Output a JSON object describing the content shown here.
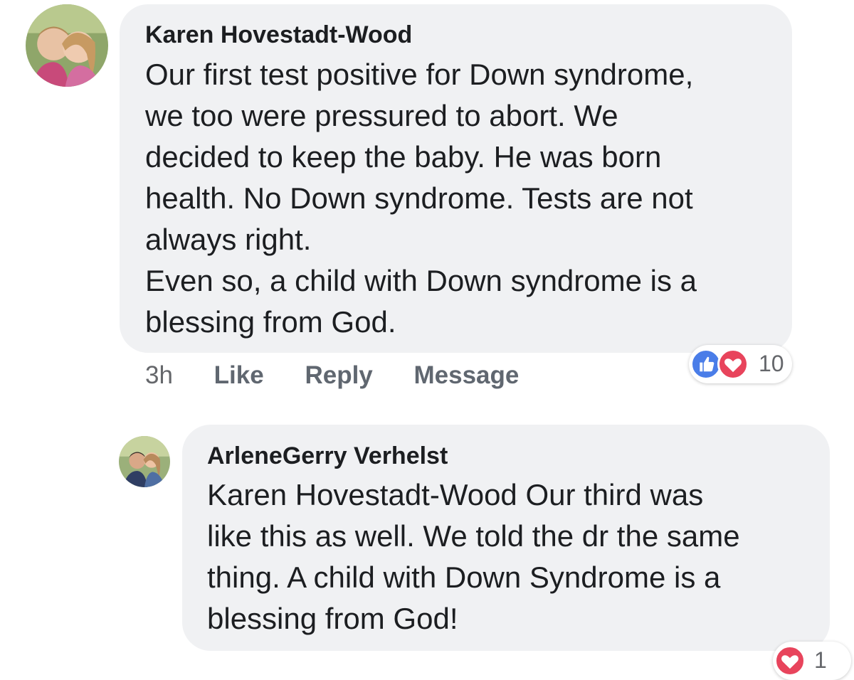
{
  "colors": {
    "bubble": "#f0f1f3",
    "like_blue": "#4a7de8",
    "love_red": "#e8445c",
    "meta_text": "#65676b"
  },
  "comments": [
    {
      "author": "Karen Hovestadt-Wood",
      "text_lines": [
        "Our first test positive for Down syndrome,",
        "we too were pressured to abort. We",
        "decided to keep the baby. He was born",
        "health. No Down syndrome. Tests are not",
        "always right.",
        "Even so, a child with Down syndrome is a",
        "blessing from God."
      ],
      "time": "3h",
      "actions": {
        "like": "Like",
        "reply": "Reply",
        "message": "Message"
      },
      "reactions": {
        "icons": [
          "like-icon",
          "love-icon"
        ],
        "count": "10"
      }
    },
    {
      "author": "ArleneGerry Verhelst",
      "text_lines": [
        "Karen Hovestadt-Wood Our third was",
        "like this as well. We told the dr the same",
        "thing. A child with Down Syndrome is a",
        "blessing from God!"
      ],
      "reactions": {
        "icons": [
          "love-icon"
        ],
        "count": "1"
      }
    }
  ]
}
